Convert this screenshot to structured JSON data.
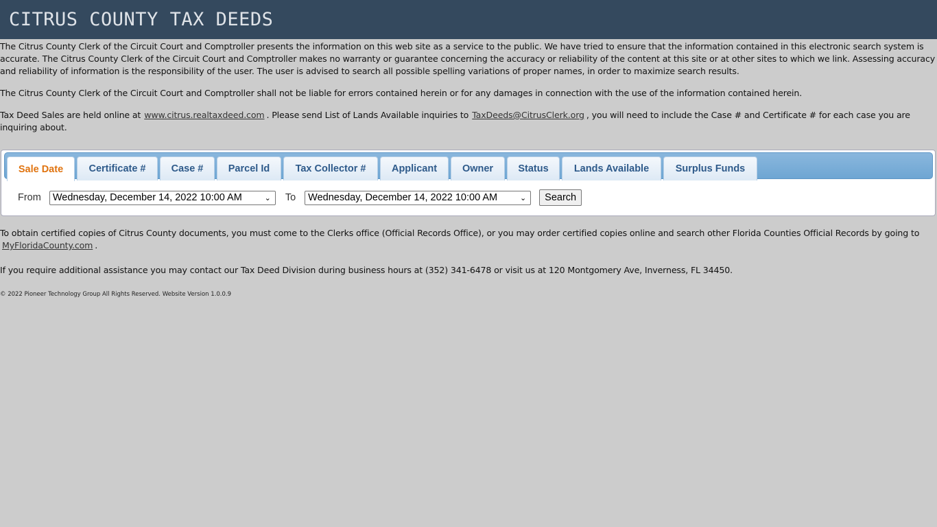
{
  "header": {
    "title": "CITRUS COUNTY TAX DEEDS"
  },
  "intro": {
    "p1": "The Citrus County Clerk of the Circuit Court and Comptroller presents the information on this web site as a service to the public. We have tried to ensure that the information contained in this electronic search system is accurate. The Citrus County Clerk of the Circuit Court and Comptroller makes no warranty or guarantee concerning the accuracy or reliability of the content at this site or at other sites to which we link. Assessing accuracy and reliability of information is the responsibility of the user. The user is advised to search all possible spelling variations of proper names, in order to maximize search results.",
    "p2": "The Citrus County Clerk of the Circuit Court and Comptroller shall not be liable for errors contained herein or for any damages in connection with the use of the information contained herein.",
    "p3_prefix": "Tax Deed Sales are held online at",
    "p3_link1": "www.citrus.realtaxdeed.com",
    "p3_middle": ". Please send List of Lands Available inquiries to",
    "p3_link2": "TaxDeeds@CitrusClerk.org",
    "p3_suffix": ", you will need to include the Case # and Certificate # for each case you are inquiring about."
  },
  "tabs": [
    {
      "label": "Sale Date",
      "active": true
    },
    {
      "label": "Certificate #"
    },
    {
      "label": "Case #"
    },
    {
      "label": "Parcel Id"
    },
    {
      "label": "Tax Collector #"
    },
    {
      "label": "Applicant"
    },
    {
      "label": "Owner"
    },
    {
      "label": "Status"
    },
    {
      "label": "Lands Available"
    },
    {
      "label": "Surplus Funds"
    }
  ],
  "filter": {
    "from_label": "From",
    "from_value": "Wednesday, December 14, 2022 10:00 AM",
    "to_label": "To",
    "to_value": "Wednesday, December 14, 2022 10:00 AM",
    "search_label": "Search"
  },
  "bottom": {
    "p1_text": "To obtain certified copies of Citrus County documents, you must come to the Clerks office (Official Records Office), or you may order certified copies online and search other Florida Counties Official Records by going to",
    "p1_link": "MyFloridaCounty.com",
    "p1_end": ".",
    "p2": "If you require additional assistance you may contact our Tax Deed Division during business hours at (352) 341-6478 or visit us at 120 Montgomery Ave, Inverness, FL 34450.",
    "footer": "© 2022 Pioneer Technology Group All Rights Reserved. Website Version 1.0.0.9"
  },
  "colors": {
    "header_bg": "#34495e",
    "page_bg": "#cccccc",
    "active_tab_text": "#e07410",
    "tab_text": "#2e5a8a"
  }
}
